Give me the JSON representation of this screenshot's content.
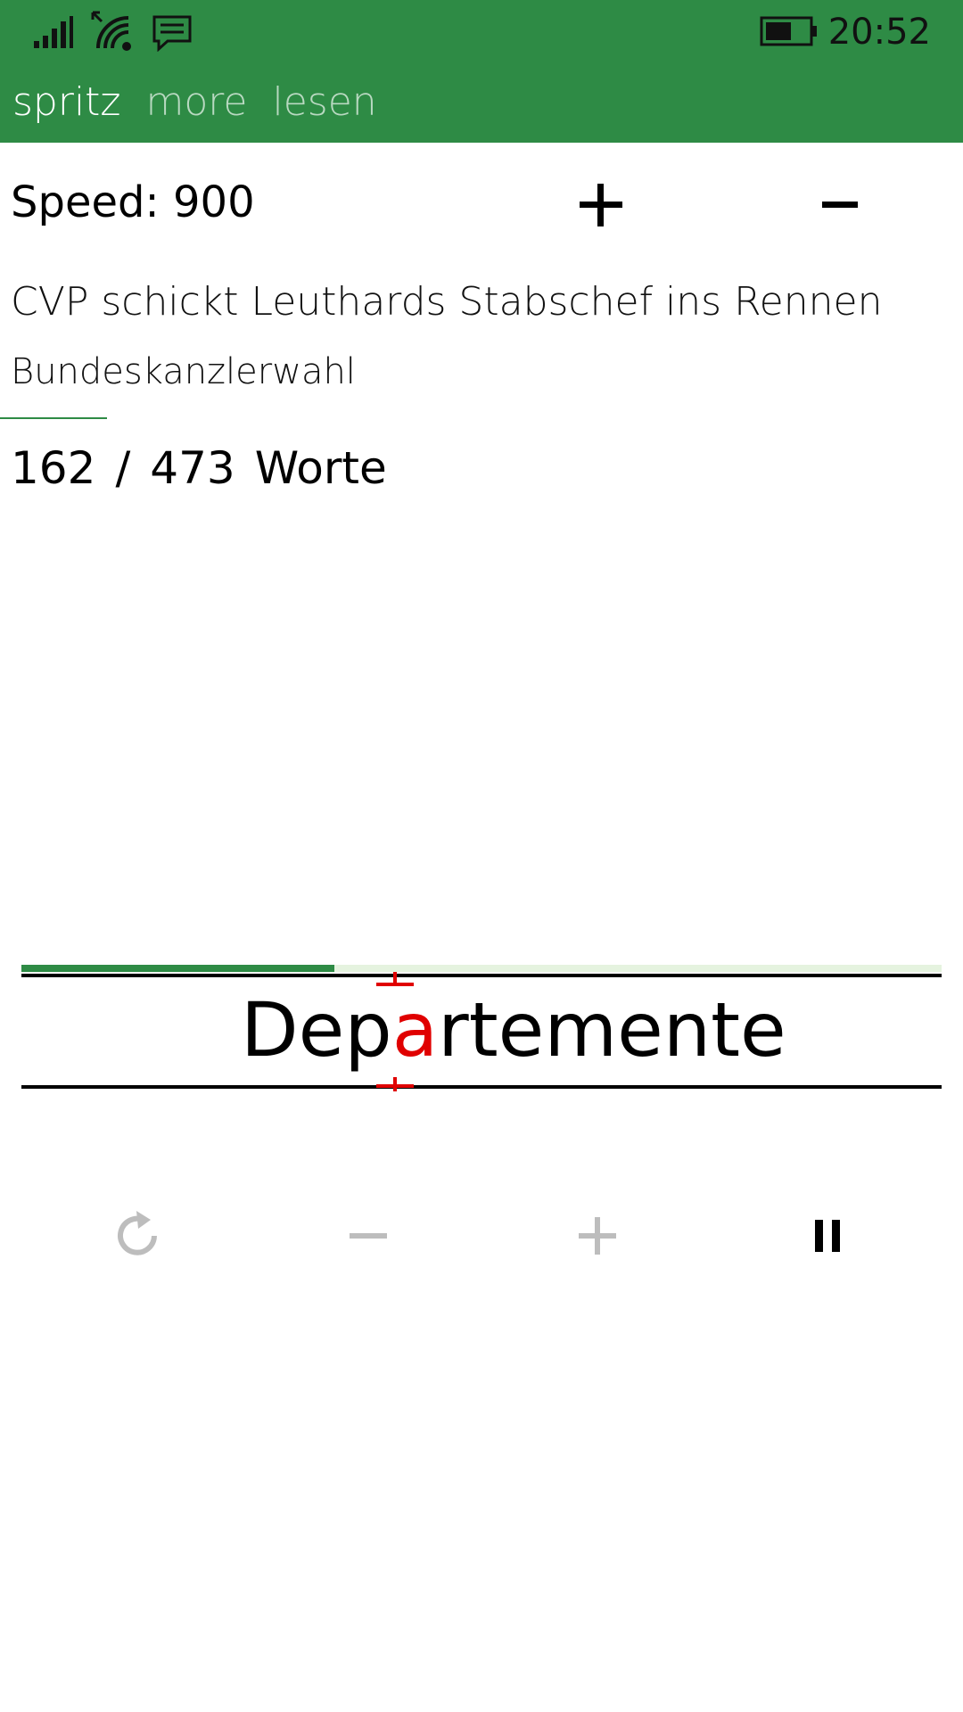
{
  "status_bar": {
    "time": "20:52",
    "icons": [
      "signal-bars-icon",
      "wifi-icon",
      "message-icon",
      "battery-icon"
    ]
  },
  "pivot": {
    "items": [
      {
        "label": "spritz",
        "active": true
      },
      {
        "label": "more",
        "active": false
      },
      {
        "label": "lesen",
        "active": false
      }
    ]
  },
  "speed": {
    "label": "Speed:",
    "value": "900",
    "increase_icon": "plus-icon",
    "decrease_icon": "minus-icon"
  },
  "article": {
    "title": "CVP schickt Leuthards Stabschef ins Rennen",
    "subtitle": "Bundeskanzlerwahl"
  },
  "word_count": {
    "current": "162",
    "separator": "/",
    "total": "473",
    "unit": "Worte"
  },
  "reader": {
    "progress_fraction": 0.34,
    "word_prefix": "Dep",
    "word_focus": "a",
    "word_suffix": "rtemente"
  },
  "controls": {
    "restart_icon": "restart-icon",
    "slower_icon": "minus-icon",
    "faster_icon": "plus-icon",
    "pause_icon": "pause-icon"
  },
  "colors": {
    "accent": "#2e8b45",
    "focus_letter": "#e00000",
    "disabled": "#bdbdbd"
  }
}
